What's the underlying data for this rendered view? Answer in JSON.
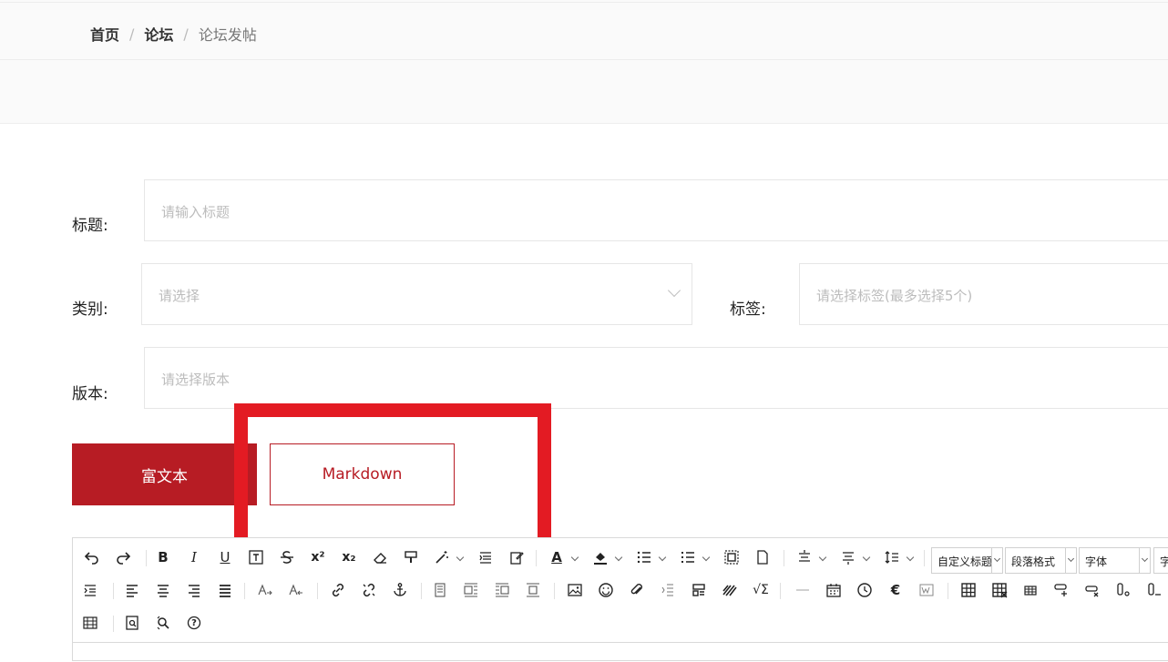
{
  "breadcrumb": {
    "home": "首页",
    "forum": "论坛",
    "current": "论坛发帖",
    "separator": "/"
  },
  "form": {
    "title_label": "标题:",
    "title_placeholder": "请输入标题",
    "category_label": "类别:",
    "category_placeholder": "请选择",
    "tags_label": "标签:",
    "tags_placeholder": "请选择标签(最多选择5个)",
    "version_label": "版本:",
    "version_placeholder": "请选择版本"
  },
  "editor_mode": {
    "rich_text": "富文本",
    "markdown": "Markdown",
    "active": "富文本"
  },
  "toolbar": {
    "combos": {
      "custom_heading": "自定义标题",
      "paragraph_format": "段落格式",
      "font_family": "字体",
      "font_size": "字"
    },
    "glyphs": {
      "bold": "B",
      "italic": "I",
      "underline": "U",
      "superscript": "x²",
      "subscript": "x₂",
      "font_color": "A",
      "euro": "€",
      "formula": "√Σ",
      "help": "?"
    }
  },
  "colors": {
    "accent": "#b71c24",
    "highlight": "#e31b23"
  }
}
